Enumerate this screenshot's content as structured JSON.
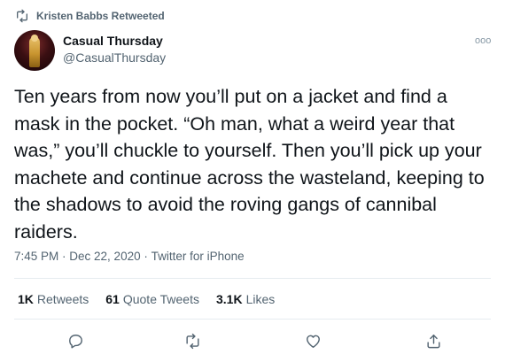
{
  "retweet_header": {
    "icon": "retweet-icon",
    "text": "Kristen Babbs Retweeted"
  },
  "author": {
    "display_name": "Casual Thursday",
    "handle": "@CasualThursday",
    "avatar": "avatar-image"
  },
  "more_menu": {
    "icon": "more-dots-icon",
    "glyph": "ooo"
  },
  "tweet": {
    "text": "Ten years from now you’ll put on a jacket and find a mask in the pocket. “Oh man, what a weird year that was,” you’ll chuckle to yourself. Then you’ll pick up your machete and continue across the wasteland, keeping to the shadows to avoid the roving gangs of cannibal raiders."
  },
  "meta": {
    "time": "7:45 PM",
    "separator": " · ",
    "date": "Dec 22, 2020",
    "source": "Twitter for iPhone"
  },
  "stats": {
    "retweets": {
      "count": "1K",
      "label": "Retweets"
    },
    "quotes": {
      "count": "61",
      "label": "Quote Tweets"
    },
    "likes": {
      "count": "3.1K",
      "label": "Likes"
    }
  },
  "actions": [
    {
      "name": "reply",
      "icon": "reply-icon"
    },
    {
      "name": "retweet",
      "icon": "retweet-icon"
    },
    {
      "name": "like",
      "icon": "heart-icon"
    },
    {
      "name": "share",
      "icon": "share-icon"
    }
  ],
  "colors": {
    "text": "#0f1419",
    "secondary": "#536471",
    "divider": "#e6ecf0"
  }
}
